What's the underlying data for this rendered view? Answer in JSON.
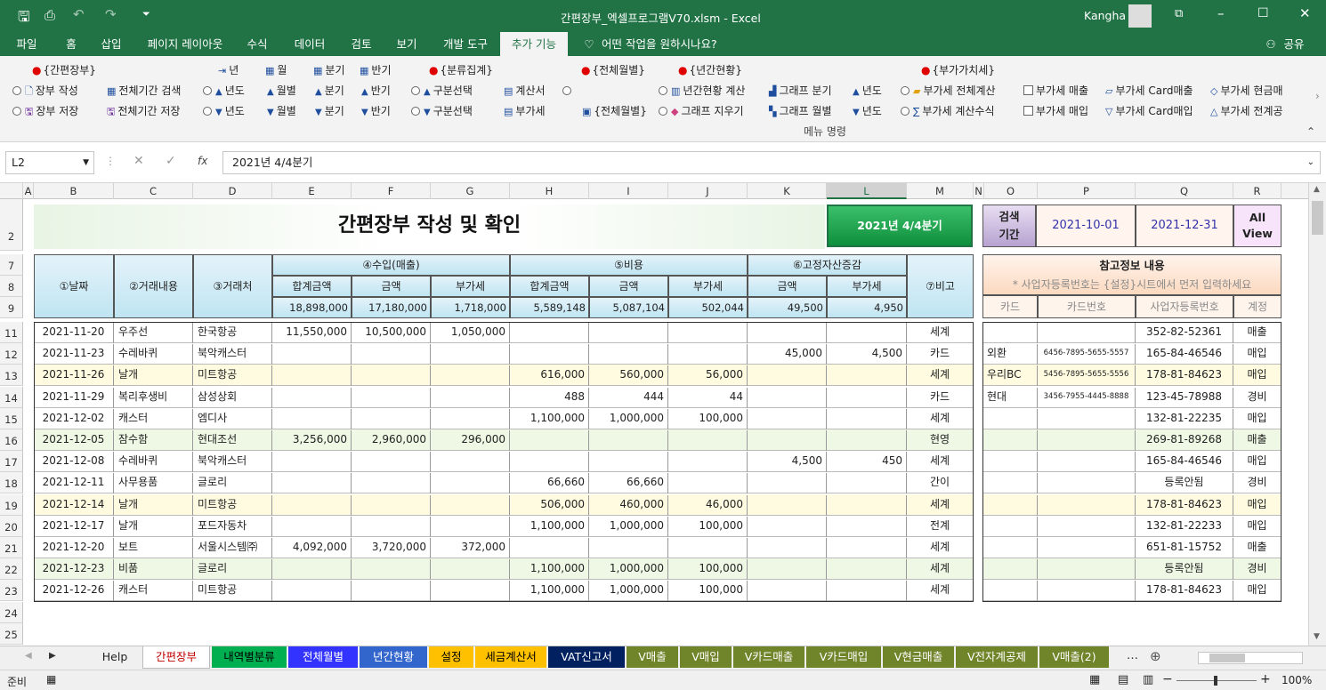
{
  "title": {
    "file": "간편장부_엑셀프로그램V70.xlsm  -  Excel",
    "user": "Kangha"
  },
  "ribbon_tabs": [
    "파일",
    "홈",
    "삽입",
    "페이지 레이아웃",
    "수식",
    "데이터",
    "검토",
    "보기",
    "개발 도구",
    "추가 기능",
    "어떤 작업을 원하시나요?",
    "공유"
  ],
  "ribbon": {
    "groups": [
      "{간편장부}",
      "{분류집계}",
      "{전체월별}",
      "{년간현황}",
      "{부가가치세}"
    ],
    "toggles": [
      "년",
      "월",
      "분기",
      "반기"
    ],
    "book_save": [
      "장부 작성",
      "장부 저장",
      "전체기간 검색",
      "전체기간 저장"
    ],
    "nav": [
      "년도",
      "월별",
      "분기",
      "반기",
      "구분선택"
    ],
    "misc": [
      "계산서",
      "부가세",
      "{전체월별}",
      "년간현황 계산",
      "그래프 지우기",
      "그래프 분기",
      "그래프 월별",
      "년도"
    ],
    "vat": [
      "부가세 전체계산",
      "부가세 계산수식",
      "부가세 매출",
      "부가세 매입",
      "부가세 Card매출",
      "부가세 Card매입",
      "부가세 현금매",
      "부가세 전계공"
    ],
    "caption": "메뉴 명령"
  },
  "formula": {
    "namebox": "L2",
    "fx": "fx",
    "content": "2021년 4/4분기"
  },
  "columns": [
    "A",
    "B",
    "C",
    "D",
    "E",
    "F",
    "G",
    "H",
    "I",
    "J",
    "K",
    "L",
    "M",
    "N",
    "O",
    "P",
    "Q",
    "R"
  ],
  "rows": [
    "2",
    "7",
    "8",
    "9",
    "11",
    "12",
    "13",
    "14",
    "15",
    "16",
    "17",
    "18",
    "19",
    "20",
    "21",
    "22",
    "23",
    "24",
    "25"
  ],
  "sheet": {
    "title": "간편장부 작성 및 확인",
    "period_label": "2021년 4/4분기",
    "search_label": "검색 기간",
    "date_from": "2021-10-01",
    "date_to": "2021-12-31",
    "all_view": "All View",
    "h_date": "①날짜",
    "h_desc": "②거래내용",
    "h_party": "③거래처",
    "h_income": "④수입(매출)",
    "h_cost": "⑤비용",
    "h_asset": "⑥고정자산증감",
    "h_note": "⑦비고",
    "sub": [
      "합계금액",
      "금액",
      "부가세",
      "합계금액",
      "금액",
      "부가세",
      "금액",
      "부가세"
    ],
    "totals": [
      "18,898,000",
      "17,180,000",
      "1,718,000",
      "5,589,148",
      "5,087,104",
      "502,044",
      "49,500",
      "4,950"
    ],
    "ref_title": "참고정보 내용",
    "ref_note": "* 사업자등록번호는 {설정}시트에서 먼저 입력하세요",
    "ref_cols": [
      "카드",
      "카드번호",
      "사업자등록번호",
      "계정"
    ]
  },
  "table": [
    [
      "2021-11-20",
      "우주선",
      "한국항공",
      "11,550,000",
      "10,500,000",
      "1,050,000",
      "",
      "",
      "",
      "",
      "",
      "세계",
      "",
      "",
      "352-82-52361",
      "매출"
    ],
    [
      "2021-11-23",
      "수레바퀴",
      "북악캐스터",
      "",
      "",
      "",
      "",
      "",
      "",
      "45,000",
      "4,500",
      "카드",
      "외환",
      "6456-7895-5655-5557",
      "165-84-46546",
      "매입"
    ],
    [
      "2021-11-26",
      "날개",
      "미트항공",
      "",
      "",
      "",
      "616,000",
      "560,000",
      "56,000",
      "",
      "",
      "세계",
      "우리BC",
      "5456-7895-5655-5556",
      "178-81-84623",
      "매입"
    ],
    [
      "2021-11-29",
      "복리후생비",
      "삼성상회",
      "",
      "",
      "",
      "488",
      "444",
      "44",
      "",
      "",
      "카드",
      "현대",
      "3456-7955-4445-8888",
      "123-45-78988",
      "경비"
    ],
    [
      "2021-12-02",
      "캐스터",
      "엠디사",
      "",
      "",
      "",
      "1,100,000",
      "1,000,000",
      "100,000",
      "",
      "",
      "세계",
      "",
      "",
      "132-81-22235",
      "매입"
    ],
    [
      "2021-12-05",
      "잠수함",
      "현대조선",
      "3,256,000",
      "2,960,000",
      "296,000",
      "",
      "",
      "",
      "",
      "",
      "현영",
      "",
      "",
      "269-81-89268",
      "매출"
    ],
    [
      "2021-12-08",
      "수레바퀴",
      "북악캐스터",
      "",
      "",
      "",
      "",
      "",
      "",
      "4,500",
      "450",
      "세계",
      "",
      "",
      "165-84-46546",
      "매입"
    ],
    [
      "2021-12-11",
      "사무용품",
      "글로리",
      "",
      "",
      "",
      "66,660",
      "66,660",
      "",
      "",
      "",
      "간이",
      "",
      "",
      "등록안됨",
      "경비"
    ],
    [
      "2021-12-14",
      "날개",
      "미트항공",
      "",
      "",
      "",
      "506,000",
      "460,000",
      "46,000",
      "",
      "",
      "세계",
      "",
      "",
      "178-81-84623",
      "매입"
    ],
    [
      "2021-12-17",
      "날개",
      "포드자동차",
      "",
      "",
      "",
      "1,100,000",
      "1,000,000",
      "100,000",
      "",
      "",
      "전계",
      "",
      "",
      "132-81-22233",
      "매입"
    ],
    [
      "2021-12-20",
      "보트",
      "서울시스템㈜",
      "4,092,000",
      "3,720,000",
      "372,000",
      "",
      "",
      "",
      "",
      "",
      "세계",
      "",
      "",
      "651-81-15752",
      "매출"
    ],
    [
      "2021-12-23",
      "비품",
      "글로리",
      "",
      "",
      "",
      "1,100,000",
      "1,000,000",
      "100,000",
      "",
      "",
      "세계",
      "",
      "",
      "등록안됨",
      "경비"
    ],
    [
      "2021-12-26",
      "캐스터",
      "미트항공",
      "",
      "",
      "",
      "1,100,000",
      "1,000,000",
      "100,000",
      "",
      "",
      "세계",
      "",
      "",
      "178-81-84623",
      "매입"
    ]
  ],
  "row_colors": [
    "#ffffff",
    "#ffffff",
    "#fffbe0",
    "#ffffff",
    "#ffffff",
    "#eef8e4",
    "#ffffff",
    "#ffffff",
    "#fffbe0",
    "#ffffff",
    "#ffffff",
    "#eef8e4",
    "#ffffff"
  ],
  "sheet_tabs": [
    {
      "label": "Help",
      "bg": "#f0f0f0",
      "fg": "#222"
    },
    {
      "label": "간편장부",
      "bg": "#ffffff",
      "fg": "#c00000"
    },
    {
      "label": "내역별분류",
      "bg": "#00b050",
      "fg": "#000"
    },
    {
      "label": "전체월별",
      "bg": "#3333ff",
      "fg": "#fff"
    },
    {
      "label": "년간현황",
      "bg": "#3366cc",
      "fg": "#fff"
    },
    {
      "label": "설정",
      "bg": "#ffc000",
      "fg": "#000"
    },
    {
      "label": "세금계산서",
      "bg": "#ffc000",
      "fg": "#000"
    },
    {
      "label": "VAT신고서",
      "bg": "#002060",
      "fg": "#fff"
    },
    {
      "label": "V매출",
      "bg": "#70842a",
      "fg": "#fff"
    },
    {
      "label": "V매입",
      "bg": "#70842a",
      "fg": "#fff"
    },
    {
      "label": "V카드매출",
      "bg": "#70842a",
      "fg": "#fff"
    },
    {
      "label": "V카드매입",
      "bg": "#70842a",
      "fg": "#fff"
    },
    {
      "label": "V현금매출",
      "bg": "#70842a",
      "fg": "#fff"
    },
    {
      "label": "V전자계공제",
      "bg": "#70842a",
      "fg": "#fff"
    },
    {
      "label": "V매출(2)",
      "bg": "#70842a",
      "fg": "#fff"
    }
  ],
  "status": {
    "ready": "준비",
    "zoom": "100%"
  },
  "colors": {
    "excel_green": "#217346",
    "header_blue": "#bfe4f2",
    "ref_orange": "#fde3cf"
  }
}
